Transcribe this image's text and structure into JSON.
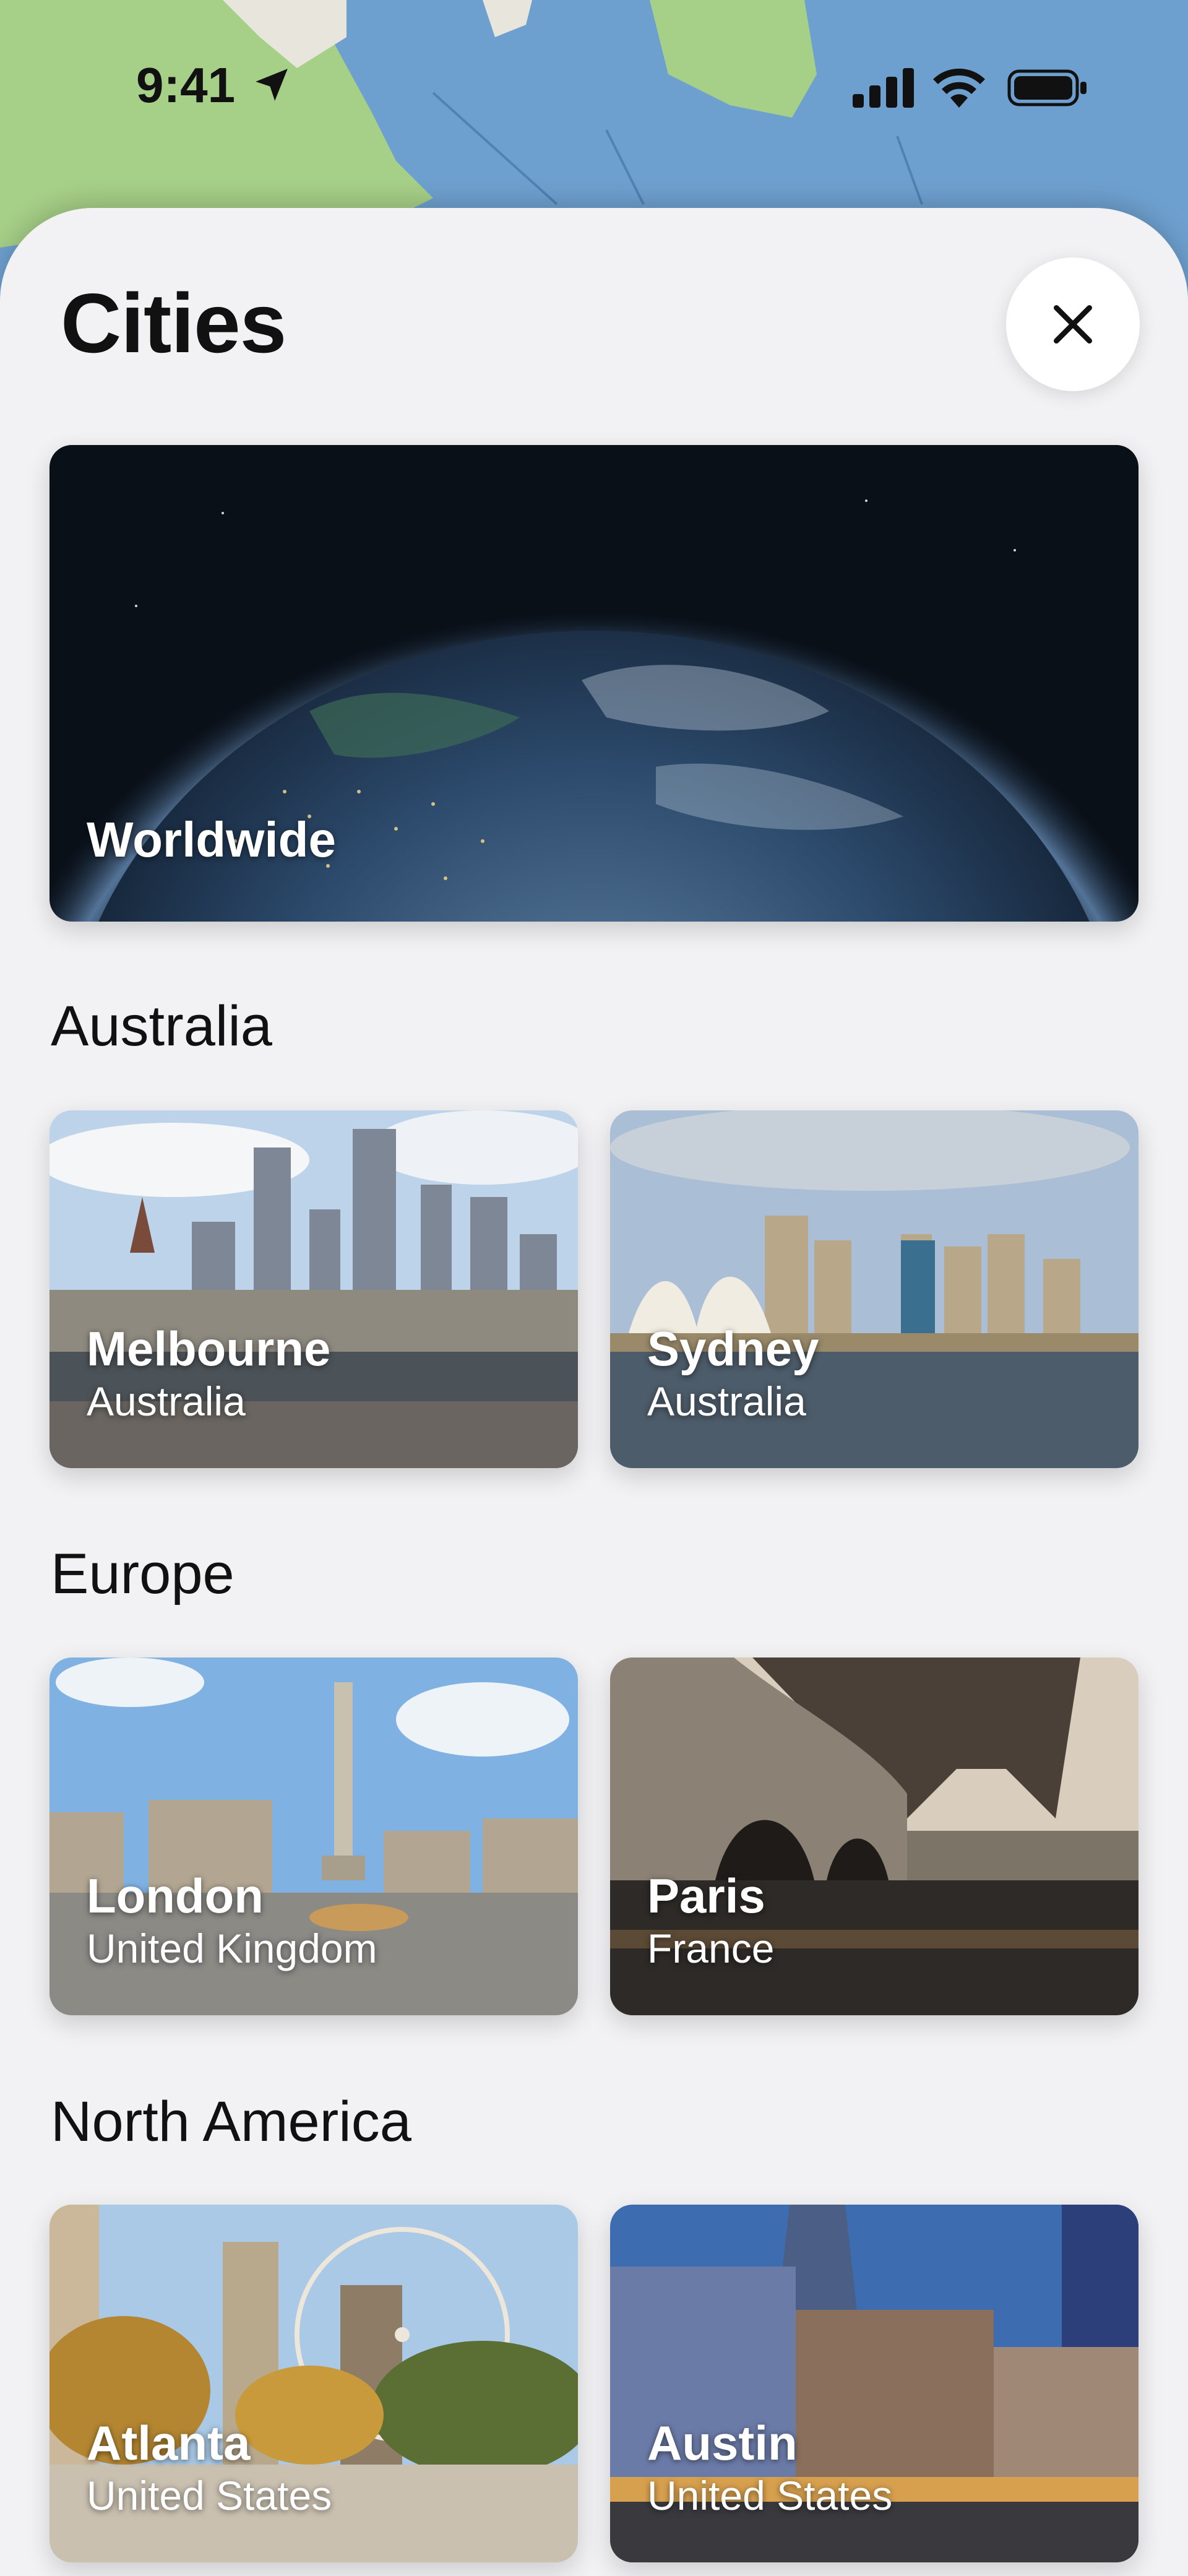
{
  "status_bar": {
    "time": "9:41"
  },
  "header": {
    "title": "Cities",
    "close_icon": "close-icon"
  },
  "featured": {
    "name": "Worldwide"
  },
  "sections": [
    {
      "title": "Australia",
      "cities": [
        {
          "name": "Melbourne",
          "country": "Australia"
        },
        {
          "name": "Sydney",
          "country": "Australia"
        }
      ]
    },
    {
      "title": "Europe",
      "cities": [
        {
          "name": "London",
          "country": "United Kingdom"
        },
        {
          "name": "Paris",
          "country": "France"
        }
      ]
    },
    {
      "title": "North America",
      "cities": [
        {
          "name": "Atlanta",
          "country": "United States"
        },
        {
          "name": "Austin",
          "country": "United States"
        }
      ]
    }
  ],
  "colors": {
    "sheet": "#f2f2f4",
    "text": "#111111",
    "card_text": "#ffffff",
    "map_water": "#6ea0cf",
    "map_land": "#a6cf87"
  }
}
